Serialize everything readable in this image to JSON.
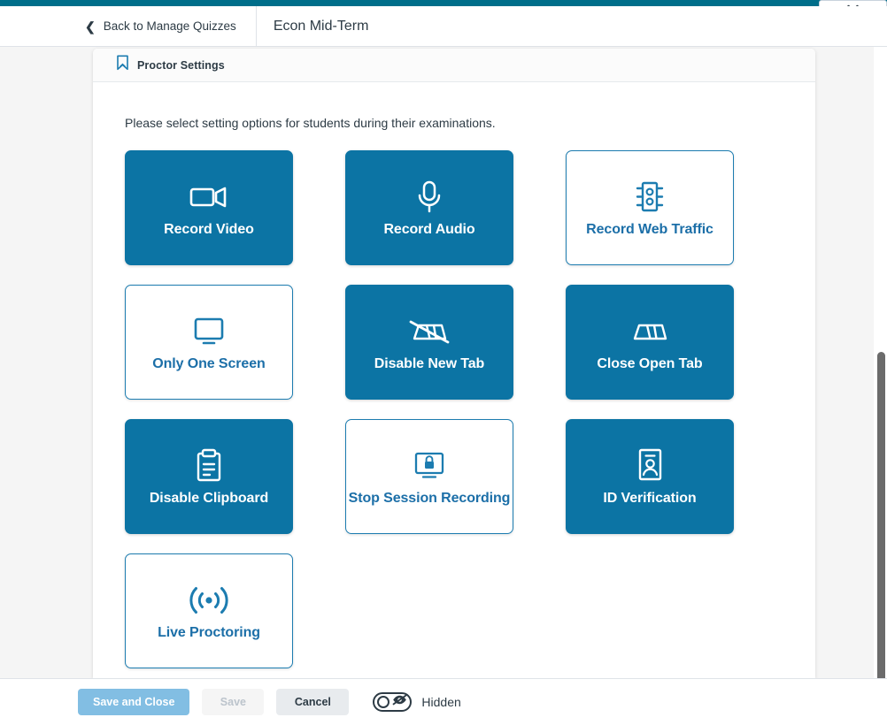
{
  "topbar": {
    "accent_color": "#006e8a",
    "dropdown_icon": "chevron-down-icon"
  },
  "header": {
    "back_label": "Back to Manage Quizzes",
    "back_icon": "chevron-left-icon",
    "quiz_title": "Econ Mid-Term"
  },
  "panel": {
    "title": "Proctor Settings",
    "title_icon": "bookmark-icon",
    "intro": "Please select setting options for students during their examinations.",
    "selected_color": "#0c74a4",
    "unselected_border_color": "#1c7cb0",
    "unselected_text_color": "#1c6fa8",
    "options": [
      {
        "label": "Record Video",
        "icon": "video-camera-icon",
        "state": "on",
        "name": "record-video"
      },
      {
        "label": "Record Audio",
        "icon": "microphone-icon",
        "state": "on",
        "name": "record-audio"
      },
      {
        "label": "Record Web Traffic",
        "icon": "traffic-light-icon",
        "state": "off",
        "name": "record-web-traffic"
      },
      {
        "label": "Only One Screen",
        "icon": "monitor-icon",
        "state": "off",
        "name": "only-one-screen"
      },
      {
        "label": "Disable New Tab",
        "icon": "tabs-slashed-icon",
        "state": "on",
        "name": "disable-new-tab"
      },
      {
        "label": "Close Open Tab",
        "icon": "tabs-icon",
        "state": "on",
        "name": "close-open-tab"
      },
      {
        "label": "Disable Clipboard",
        "icon": "clipboard-icon",
        "state": "on",
        "name": "disable-clipboard"
      },
      {
        "label": "Stop Session Recording",
        "icon": "monitor-lock-icon",
        "state": "off",
        "name": "stop-session-recording"
      },
      {
        "label": "ID Verification",
        "icon": "id-card-icon",
        "state": "on",
        "name": "id-verification"
      },
      {
        "label": "Live Proctoring",
        "icon": "broadcast-icon",
        "state": "off",
        "name": "live-proctoring"
      }
    ]
  },
  "footer": {
    "save_and_close_label": "Save and Close",
    "save_label": "Save",
    "cancel_label": "Cancel",
    "visibility_label": "Hidden",
    "visibility_icon": "eye-slash-icon",
    "visibility_state": "off"
  }
}
